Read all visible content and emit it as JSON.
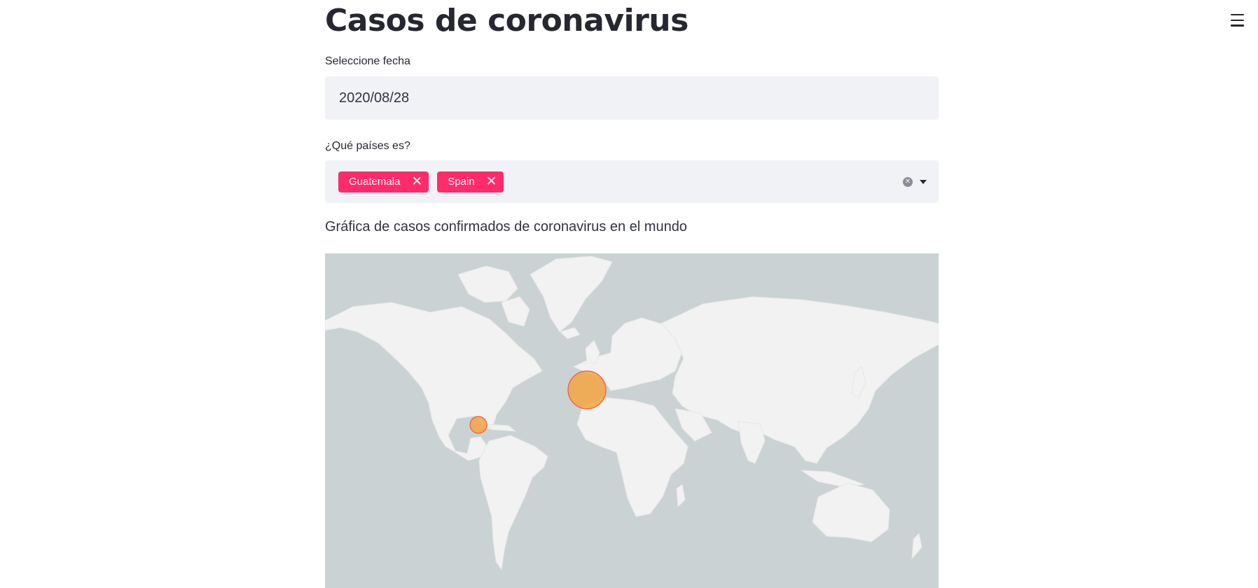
{
  "page": {
    "title": "Casos de coronavirus"
  },
  "date_picker": {
    "label": "Seleccione fecha",
    "value": "2020/08/28"
  },
  "country_select": {
    "label": "¿Qué países es?",
    "selected": [
      "Guatemala",
      "Spain"
    ],
    "remove_icon": "close-icon",
    "clear_icon": "clear-circle-icon",
    "dropdown_icon": "caret-down-icon"
  },
  "map_section": {
    "heading": "Gráfica de casos confirmados de coronavirus en el mundo",
    "markers": [
      {
        "country": "Spain",
        "lat": 40.4,
        "lon": -3.7
      },
      {
        "country": "Guatemala",
        "lat": 15.5,
        "lon": -90.2
      }
    ]
  },
  "menu": {
    "icon": "hamburger-menu-icon"
  },
  "colors": {
    "tag_bg": "#ff2b6a",
    "input_bg": "#f0f2f6",
    "ocean": "#cad2d3",
    "land": "#f2f2f2",
    "marker_fill": "#f5a442",
    "marker_stroke": "#ef5b3b"
  }
}
